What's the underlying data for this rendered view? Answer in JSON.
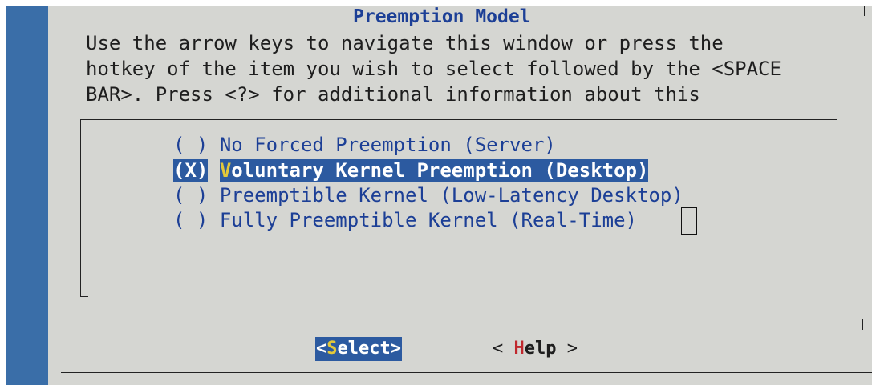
{
  "dialog": {
    "title": "Preemption Model",
    "instructions": [
      "Use the arrow keys to navigate this window or press the",
      "hotkey of the item you wish to select followed by the <SPACE",
      "BAR>. Press <?> for additional information about this"
    ]
  },
  "options": [
    {
      "radio": "( )",
      "hotkey": "N",
      "label": "o Forced Preemption (Server)",
      "selected": false
    },
    {
      "radio": "(X)",
      "hotkey": "V",
      "label": "oluntary Kernel Preemption (Desktop)",
      "selected": true
    },
    {
      "radio": "( )",
      "hotkey": "P",
      "label": "reemptible Kernel (Low-Latency Desktop)",
      "selected": false
    },
    {
      "radio": "( )",
      "hotkey": "F",
      "label": "ully Preemptible Kernel (Real-Time)",
      "selected": false
    }
  ],
  "buttons": {
    "select": {
      "open": "<",
      "hotkey": "S",
      "rest": "elect>"
    },
    "help": {
      "open": "< ",
      "hotkey": "H",
      "rest": "elp",
      "close": " >"
    }
  },
  "colors": {
    "terminal_bg": "#3a6ea8",
    "dialog_bg": "#d5d6d2",
    "highlight_bg": "#2c5aa0",
    "highlight_hotkey": "#e2c83a",
    "text_blue": "#1c3f96",
    "help_hotkey": "#c0282d"
  }
}
